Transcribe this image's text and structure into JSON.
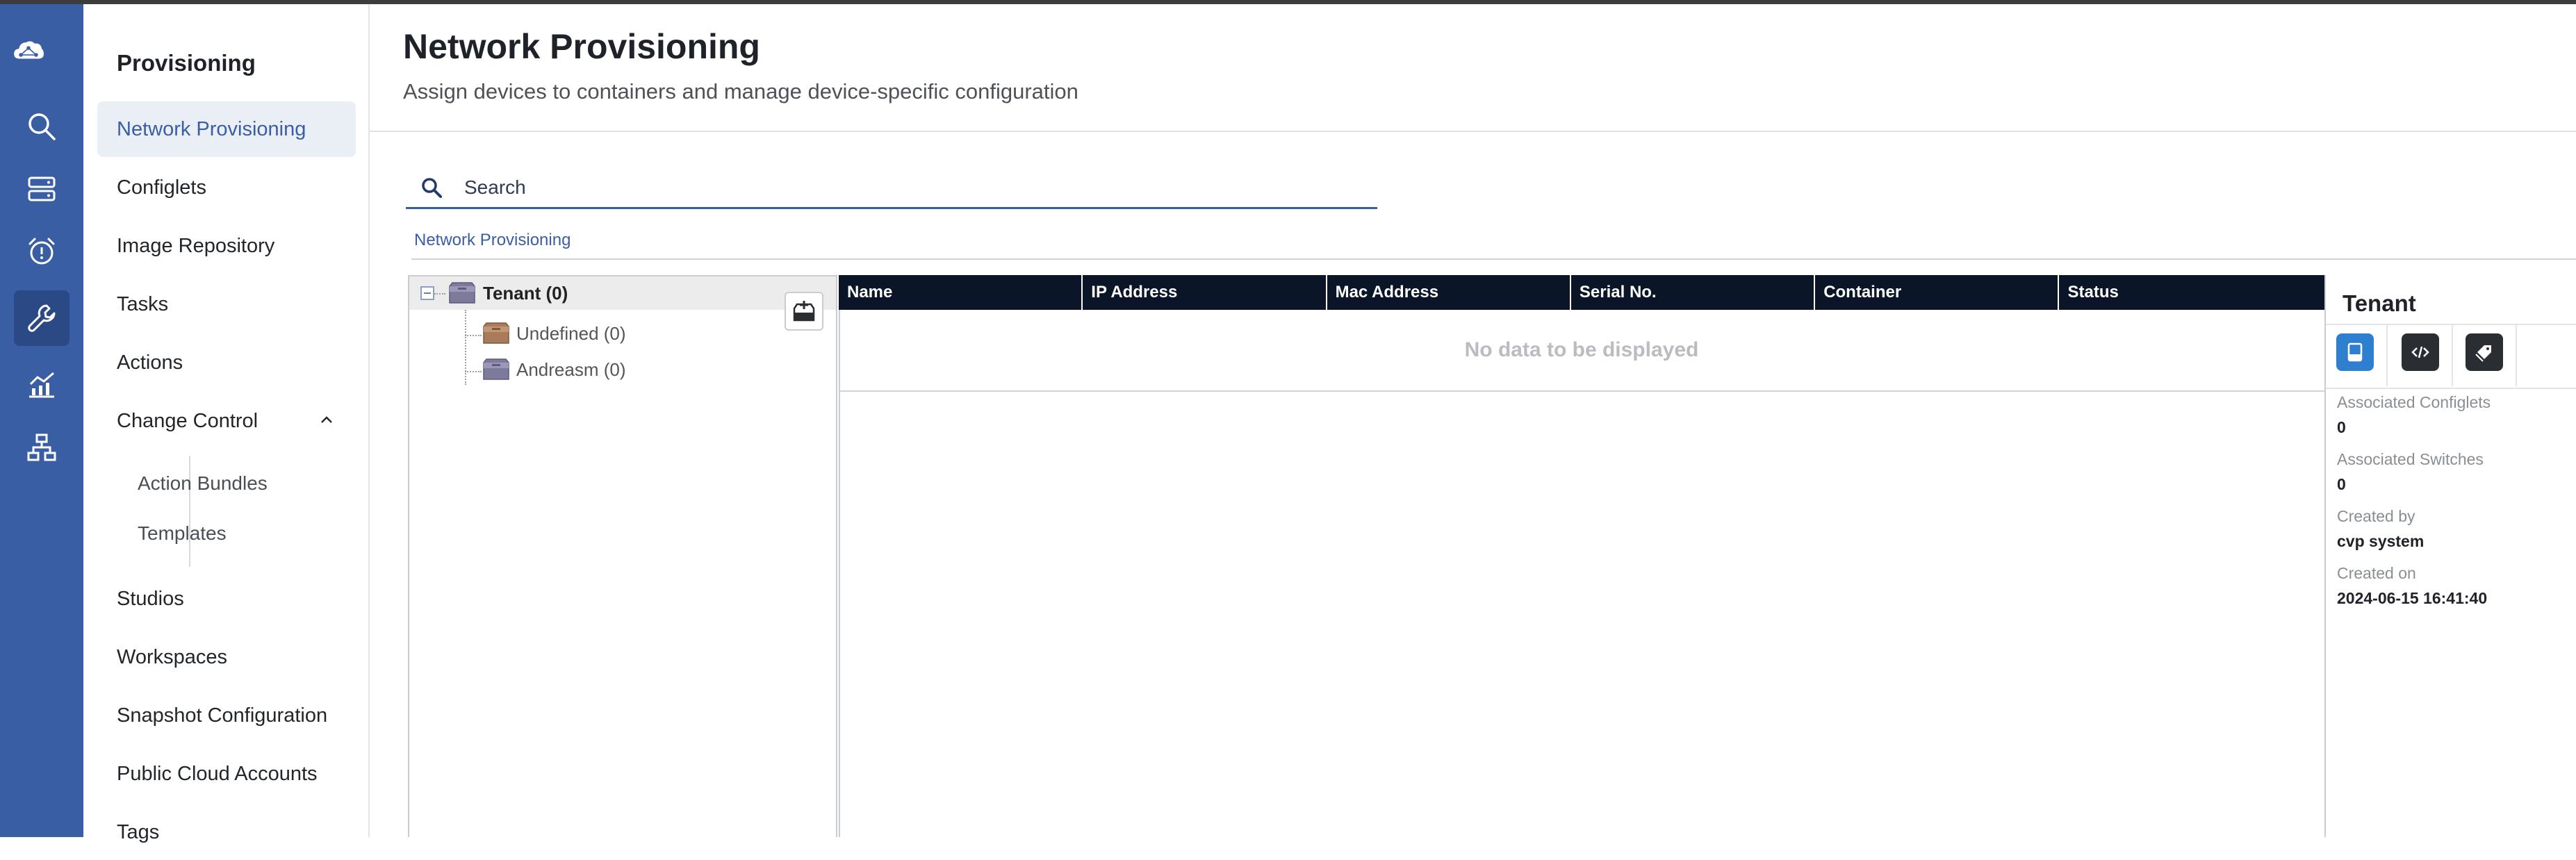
{
  "colors": {
    "rail": "#3a5ea4",
    "accent": "#3a5ea4",
    "table_header": "#0a1628"
  },
  "rail": {
    "icons": [
      "cloud-logo-icon",
      "search-icon",
      "devices-icon",
      "alarm-icon",
      "wrench-icon",
      "metrics-icon",
      "topology-icon"
    ],
    "active": "wrench-icon"
  },
  "sidebar": {
    "heading": "Provisioning",
    "items": [
      {
        "label": "Network Provisioning"
      },
      {
        "label": "Configlets"
      },
      {
        "label": "Image Repository"
      },
      {
        "label": "Tasks"
      },
      {
        "label": "Actions"
      },
      {
        "label": "Change Control"
      },
      {
        "label": "Action Bundles"
      },
      {
        "label": "Templates"
      },
      {
        "label": "Studios"
      },
      {
        "label": "Workspaces"
      },
      {
        "label": "Snapshot Configuration"
      },
      {
        "label": "Public Cloud Accounts"
      },
      {
        "label": "Tags"
      }
    ],
    "active": "Network Provisioning"
  },
  "header": {
    "title": "Network Provisioning",
    "subtitle": "Assign devices to containers and manage device-specific configuration"
  },
  "search": {
    "placeholder": "Search"
  },
  "breadcrumb": {
    "current": "Network Provisioning"
  },
  "tree": {
    "root": {
      "label": "Tenant (0)"
    },
    "children": [
      {
        "label": "Undefined (0)"
      },
      {
        "label": "Andreasm (0)"
      }
    ]
  },
  "table": {
    "columns": [
      "Name",
      "IP Address",
      "Mac Address",
      "Serial No.",
      "Container",
      "Status"
    ],
    "empty_message": "No data to be displayed"
  },
  "info": {
    "name": "Tenant",
    "fields": [
      {
        "label": "Associated Configlets",
        "value": "0"
      },
      {
        "label": "Associated Switches",
        "value": "0"
      },
      {
        "label": "Created by",
        "value": "cvp system"
      },
      {
        "label": "Created on",
        "value": "2024-06-15 16:41:40"
      }
    ]
  }
}
